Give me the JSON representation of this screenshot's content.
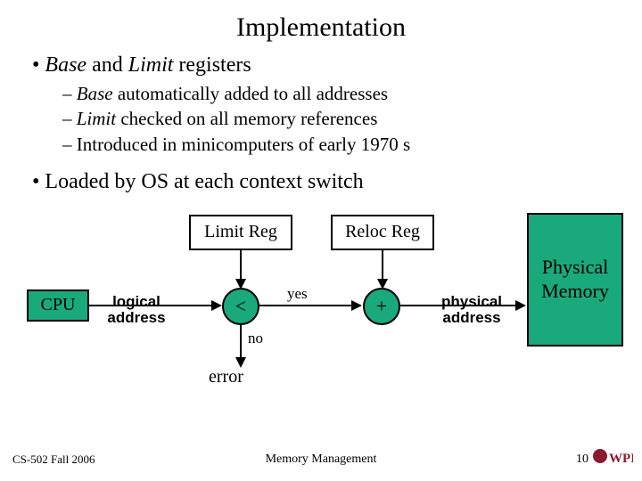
{
  "title": "Implementation",
  "bullets": {
    "b1a_italic": "Base",
    "b1a_mid": " and ",
    "b1a_italic2": "Limit",
    "b1a_tail": " registers",
    "b2a_italic": "Base",
    "b2a_tail": " automatically added to all addresses",
    "b2b_italic": "Limit",
    "b2b_tail": " checked on all memory references",
    "b2c": "Introduced in minicomputers of early 1970 s",
    "b1b": "Loaded by OS at each context switch"
  },
  "diagram": {
    "cpu": "CPU",
    "limit_reg": "Limit Reg",
    "reloc_reg": "Reloc Reg",
    "lt": "<",
    "plus": "+",
    "phys_mem_l1": "Physical",
    "phys_mem_l2": "Memory",
    "logical_l1": "logical",
    "logical_l2": "address",
    "physical_l1": "physical",
    "physical_l2": "address",
    "yes": "yes",
    "no": "no",
    "error": "error"
  },
  "footer": {
    "left": "CS-502 Fall 2006",
    "center": "Memory Management",
    "right": "10",
    "logo_text": "WPI"
  }
}
